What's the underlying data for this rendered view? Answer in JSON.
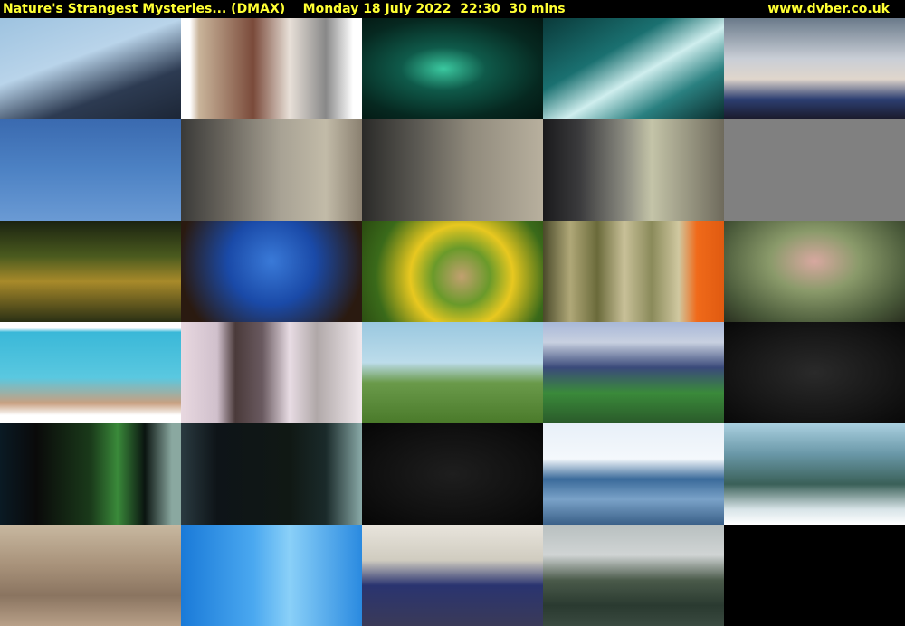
{
  "header": {
    "title": "Nature's Strangest Mysteries... (DMAX)    Monday 18 July 2022  22:30  30 mins",
    "site": "www.dvber.co.uk"
  },
  "thumbs": [
    {
      "bg": "linear-gradient(160deg,#9ec3e0 0%,#b9d4ea 40%,#2d3b52 70%,#1c2636 100%)"
    },
    {
      "bg": "linear-gradient(90deg,#fff 0%,#fff 5%,#c9b49a 10%,#7a4a3a 40%,#e8e0d8 60%,#888 80%,#fff 95%)"
    },
    {
      "bg": "radial-gradient(ellipse at 45% 50%,#3bc9a0 0%,#0f5a4a 30%,#062820 70%,#031510 100%)"
    },
    {
      "bg": "linear-gradient(150deg,#0a3a3a 0%,#1a7070 35%,#cfeeee 55%,#2a8080 75%,#0a2a2a 100%)"
    },
    {
      "bg": "linear-gradient(180deg,#6a7a8a 0%,#c9ced6 40%,#e0d6cc 60%,#2d3f72 80%,#1a1a2a 100%)"
    },
    {
      "bg": "linear-gradient(180deg,#3a6ab0 0%,#4d82c4 50%,#6a9ad4 100%)"
    },
    {
      "bg": "linear-gradient(90deg,#3a3a38 0%,#6a665e 25%,#a8a294 55%,#c2bba8 80%,#8a8070 100%)"
    },
    {
      "bg": "linear-gradient(90deg,#2a2a28 0%,#5a5852 30%,#908a7c 60%,#b8b09e 100%)"
    },
    {
      "bg": "linear-gradient(90deg,#1a1a1c 0%,#3a3a3c 20%,#8a8a80 45%,#c4c4a8 60%,#6e6a5c 100%)"
    },
    {
      "bg": "#808080"
    },
    {
      "bg": "linear-gradient(180deg,#1a2210 0%,#4a5a1e 35%,#a88a2a 60%,#2a3014 100%)"
    },
    {
      "bg": "radial-gradient(circle at 50% 40%,#3a7ad8 0%,#1a4aa8 40%,#2a1a10 85%)"
    },
    {
      "bg": "radial-gradient(circle at 55% 55%,#c2a070 0%,#6a9a2a 25%,#e8c820 45%,#3a6a1a 75%,#2a4a10 100%)"
    },
    {
      "bg": "linear-gradient(90deg,#4a4a2a 0%,#b0a878 15%,#6a6a3a 30%,#c8c098 45%,#8a8a5a 60%,#d0c8a0 75%,#f06a1a 85%,#e05a10 100%)"
    },
    {
      "bg": "radial-gradient(ellipse at 50% 40%,#d8a8a0 0%,#8a9a6a 35%,#4a5a3a 75%,#2a3020 100%)"
    },
    {
      "bg": "linear-gradient(180deg,#fff 0%,#fff 6%,#3ab8d8 10%,#5ac8e0 55%,#c8a080 80%,#fff 92%,#fff 100%)"
    },
    {
      "bg": "linear-gradient(90deg,#e8d8e0 0%,#d0c0cc 20%,#4a3a3a 30%,#6a5a60 45%,#e8dce4 60%,#b0a8a8 75%,#f0e8ec 100%)"
    },
    {
      "bg": "linear-gradient(180deg,#9ac8e0 0%,#bcdcea 40%,#6a9a4a 60%,#4a7a2a 100%)"
    },
    {
      "bg": "linear-gradient(180deg,#a8b8d8 0%,#c8d0e0 20%,#3a4a7a 45%,#3a8a3a 70%,#2a5a2a 100%)"
    },
    {
      "bg": "radial-gradient(ellipse at 50% 50%,#2a2a2a 0%,#161616 60%,#080808 100%)"
    },
    {
      "bg": "linear-gradient(90deg,#0a1a24 0%,#0a0a0a 20%,#1a3a1a 50%,#3a8a3a 65%,#0a1410 80%,#8aa8a0 95%)"
    },
    {
      "bg": "linear-gradient(90deg,#2a3a40 0%,#0e1418 20%,#101814 60%,#1a2a2a 80%,#8aaaa8 100%)"
    },
    {
      "bg": "radial-gradient(ellipse at 50% 50%,#1e1e1e 0%,#101010 60%,#060606 100%)"
    },
    {
      "bg": "linear-gradient(180deg,#e8f0f8 0%,#f4f8fc 35%,#3a6a9a 55%,#7aa2c8 75%,#3a6088 100%)"
    },
    {
      "bg": "linear-gradient(180deg,#aad0e0 0%,#6a98a8 30%,#3a6058 60%,#d8e4e8 85%,#fff 100%)"
    },
    {
      "bg": "linear-gradient(180deg,#c8b8a0 0%,#a8927a 40%,#8a7460 70%,#b8a088 100%)"
    },
    {
      "bg": "linear-gradient(90deg,#1a7ad8 0%,#4aa8f0 40%,#8ad0f8 60%,#2a8ae0 100%)"
    },
    {
      "bg": "linear-gradient(180deg,#e8e4dc 0%,#d0ccc0 35%,#2a3470 60%,#3a3a58 100%)"
    },
    {
      "bg": "linear-gradient(180deg,#b8c0c0 0%,#d0d4d4 30%,#4a5a4a 55%,#2a3a30 80%,#3a4a40 100%)"
    }
  ]
}
